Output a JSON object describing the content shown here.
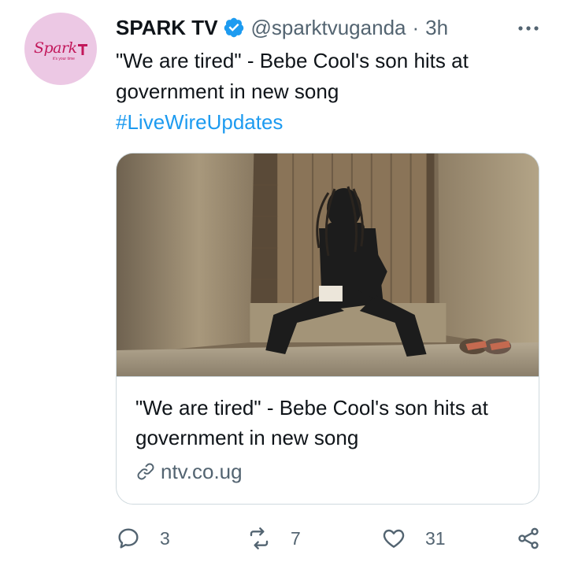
{
  "tweet": {
    "author_name": "SPARK TV",
    "author_handle": "@sparktvuganda",
    "separator": "·",
    "time": "3h",
    "avatar_logo_text": "Spark",
    "avatar_logo_sub": "it's your time",
    "text_lines": [
      "\"We are tired\" - Bebe Cool's son hits at",
      "government in new song"
    ],
    "hashtag": "#LiveWireUpdates"
  },
  "card": {
    "title_lines": [
      "\"We are tired\" - Bebe Cool's son hits at",
      "government in new song"
    ],
    "domain": "ntv.co.ug"
  },
  "actions": {
    "replies": "3",
    "retweets": "7",
    "likes": "31"
  },
  "colors": {
    "accent": "#1d9bf0",
    "muted": "#536471",
    "avatar_bg": "#ecc8e4",
    "border": "#cfd9de"
  }
}
